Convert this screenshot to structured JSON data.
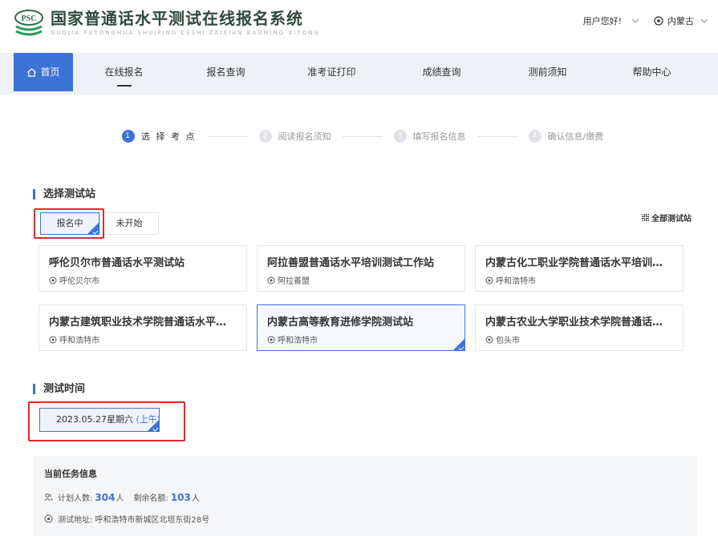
{
  "header": {
    "title": "国家普通话水平测试在线报名系统",
    "subtitle": "GUOJIA PUTONGHUA SHUIPING CESHI ZAIXIAN BAOMING XITONG",
    "logo_text": "PSC",
    "greeting": "用户您好!",
    "region": "内蒙古"
  },
  "nav": {
    "home": "首页",
    "items": [
      "在线报名",
      "报名查询",
      "准考证打印",
      "成绩查询",
      "测前须知",
      "帮助中心"
    ]
  },
  "steps": [
    {
      "num": "1",
      "label": "选 择 考 点"
    },
    {
      "num": "2",
      "label": "阅读报名须知"
    },
    {
      "num": "3",
      "label": "填写报名信息"
    },
    {
      "num": "4",
      "label": "确认信息/缴费"
    }
  ],
  "station_section": {
    "heading": "选择测试站",
    "tabs": [
      "报名中",
      "未开始"
    ],
    "all_link": "全部测试站",
    "stations": [
      {
        "name": "呼伦贝尔市普通话水平测试站",
        "city": "呼伦贝尔市"
      },
      {
        "name": "阿拉善盟普通话水平培训测试工作站",
        "city": "阿拉善盟"
      },
      {
        "name": "内蒙古化工职业学院普通话水平培训测试站",
        "city": "呼和浩特市"
      },
      {
        "name": "内蒙古建筑职业技术学院普通话水平培训测试站",
        "city": "呼和浩特市"
      },
      {
        "name": "内蒙古高等教育进修学院测试站",
        "city": "呼和浩特市"
      },
      {
        "name": "内蒙古农业大学职业技术学院普通话水平培训测试站",
        "city": "包头市"
      }
    ]
  },
  "time_section": {
    "heading": "测试时间",
    "date": "2023.05.27星期六",
    "period": "(上午)"
  },
  "task_info": {
    "title": "当前任务信息",
    "planned_label": "计划人数:",
    "planned_value": "304",
    "unit": "人",
    "remaining_label": "剩余名额:",
    "remaining_value": "103",
    "address_label": "测试地址:",
    "address": "呼和浩特市新城区北垣东街28号"
  },
  "colors": {
    "primary": "#3d73d6",
    "highlight_border": "#e02a2a"
  }
}
